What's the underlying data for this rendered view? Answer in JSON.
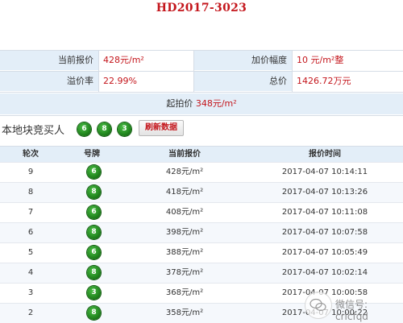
{
  "title": "HD2017-3023",
  "info": {
    "current_price_label": "当前报价",
    "current_price_value": "428元/m²",
    "increment_label": "加价幅度",
    "increment_value": "10 元/m²整",
    "premium_label": "溢价率",
    "premium_value": "22.99%",
    "total_label": "总价",
    "total_value": "1426.72万元",
    "start_label": "起拍价",
    "start_value": "348元/m²"
  },
  "bidders": {
    "label": "本地块竞买人",
    "plates": [
      "6",
      "8",
      "3"
    ],
    "refresh_label": "刷新数据"
  },
  "table": {
    "headers": [
      "轮次",
      "号牌",
      "当前报价",
      "报价时间"
    ],
    "rows": [
      {
        "round": "9",
        "plate": "6",
        "price": "428元/m²",
        "time": "2017-04-07 10:14:11"
      },
      {
        "round": "8",
        "plate": "8",
        "price": "418元/m²",
        "time": "2017-04-07 10:13:26"
      },
      {
        "round": "7",
        "plate": "6",
        "price": "408元/m²",
        "time": "2017-04-07 10:11:08"
      },
      {
        "round": "6",
        "plate": "8",
        "price": "398元/m²",
        "time": "2017-04-07 10:07:58"
      },
      {
        "round": "5",
        "plate": "6",
        "price": "388元/m²",
        "time": "2017-04-07 10:05:49"
      },
      {
        "round": "4",
        "plate": "8",
        "price": "378元/m²",
        "time": "2017-04-07 10:02:14"
      },
      {
        "round": "3",
        "plate": "3",
        "price": "368元/m²",
        "time": "2017-04-07 10:00:58"
      },
      {
        "round": "2",
        "plate": "8",
        "price": "358元/m²",
        "time": "2017-04-07 10:00:22"
      }
    ]
  },
  "watermark": {
    "text": "微信号: cricfqd",
    "icon": "wechat-icon"
  },
  "colors": {
    "accent_red": "#c4161c",
    "label_bg": "#e3eef8",
    "badge_green": "#1d7f1a"
  }
}
